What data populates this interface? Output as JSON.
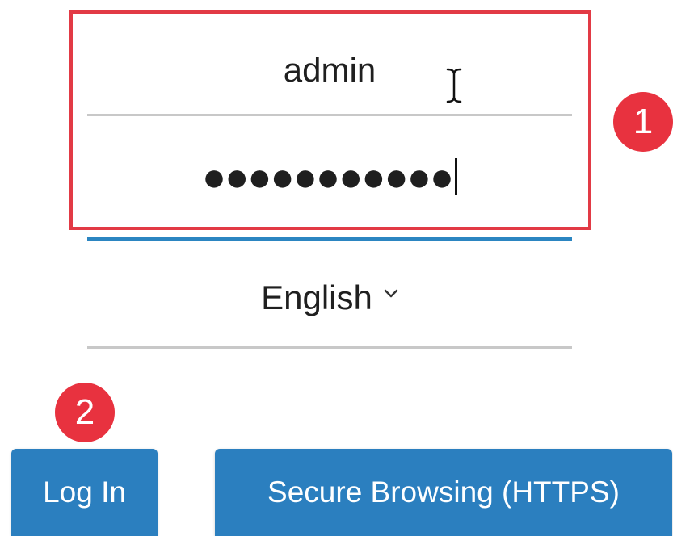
{
  "login_form": {
    "username_value": "admin",
    "password_masked": "●●●●●●●●●●●",
    "language_value": "English"
  },
  "buttons": {
    "login_label": "Log In",
    "secure_browsing_label": "Secure Browsing (HTTPS)"
  },
  "annotations": {
    "step1_number": "1",
    "step2_number": "2"
  },
  "colors": {
    "button_blue": "#2b7fbf",
    "active_underline": "#2b85c1",
    "annotation_red": "#e8323f",
    "highlight_border": "#e23a45"
  },
  "icons": {
    "cursor": "text-cursor-icon",
    "dropdown": "chevron-down-icon"
  }
}
